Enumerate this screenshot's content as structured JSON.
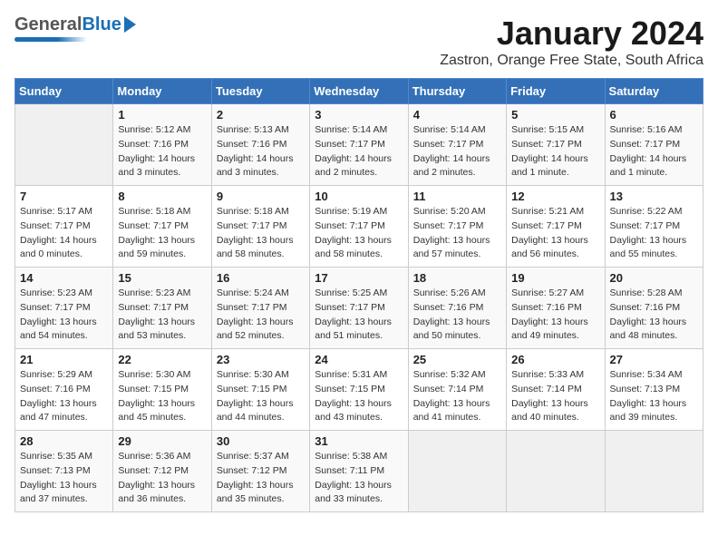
{
  "header": {
    "logo_general": "General",
    "logo_blue": "Blue",
    "month_year": "January 2024",
    "location": "Zastron, Orange Free State, South Africa"
  },
  "weekdays": [
    "Sunday",
    "Monday",
    "Tuesday",
    "Wednesday",
    "Thursday",
    "Friday",
    "Saturday"
  ],
  "weeks": [
    [
      {
        "day": "",
        "sunrise": "",
        "sunset": "",
        "daylight": ""
      },
      {
        "day": "1",
        "sunrise": "Sunrise: 5:12 AM",
        "sunset": "Sunset: 7:16 PM",
        "daylight": "Daylight: 14 hours and 3 minutes."
      },
      {
        "day": "2",
        "sunrise": "Sunrise: 5:13 AM",
        "sunset": "Sunset: 7:16 PM",
        "daylight": "Daylight: 14 hours and 3 minutes."
      },
      {
        "day": "3",
        "sunrise": "Sunrise: 5:14 AM",
        "sunset": "Sunset: 7:17 PM",
        "daylight": "Daylight: 14 hours and 2 minutes."
      },
      {
        "day": "4",
        "sunrise": "Sunrise: 5:14 AM",
        "sunset": "Sunset: 7:17 PM",
        "daylight": "Daylight: 14 hours and 2 minutes."
      },
      {
        "day": "5",
        "sunrise": "Sunrise: 5:15 AM",
        "sunset": "Sunset: 7:17 PM",
        "daylight": "Daylight: 14 hours and 1 minute."
      },
      {
        "day": "6",
        "sunrise": "Sunrise: 5:16 AM",
        "sunset": "Sunset: 7:17 PM",
        "daylight": "Daylight: 14 hours and 1 minute."
      }
    ],
    [
      {
        "day": "7",
        "sunrise": "Sunrise: 5:17 AM",
        "sunset": "Sunset: 7:17 PM",
        "daylight": "Daylight: 14 hours and 0 minutes."
      },
      {
        "day": "8",
        "sunrise": "Sunrise: 5:18 AM",
        "sunset": "Sunset: 7:17 PM",
        "daylight": "Daylight: 13 hours and 59 minutes."
      },
      {
        "day": "9",
        "sunrise": "Sunrise: 5:18 AM",
        "sunset": "Sunset: 7:17 PM",
        "daylight": "Daylight: 13 hours and 58 minutes."
      },
      {
        "day": "10",
        "sunrise": "Sunrise: 5:19 AM",
        "sunset": "Sunset: 7:17 PM",
        "daylight": "Daylight: 13 hours and 58 minutes."
      },
      {
        "day": "11",
        "sunrise": "Sunrise: 5:20 AM",
        "sunset": "Sunset: 7:17 PM",
        "daylight": "Daylight: 13 hours and 57 minutes."
      },
      {
        "day": "12",
        "sunrise": "Sunrise: 5:21 AM",
        "sunset": "Sunset: 7:17 PM",
        "daylight": "Daylight: 13 hours and 56 minutes."
      },
      {
        "day": "13",
        "sunrise": "Sunrise: 5:22 AM",
        "sunset": "Sunset: 7:17 PM",
        "daylight": "Daylight: 13 hours and 55 minutes."
      }
    ],
    [
      {
        "day": "14",
        "sunrise": "Sunrise: 5:23 AM",
        "sunset": "Sunset: 7:17 PM",
        "daylight": "Daylight: 13 hours and 54 minutes."
      },
      {
        "day": "15",
        "sunrise": "Sunrise: 5:23 AM",
        "sunset": "Sunset: 7:17 PM",
        "daylight": "Daylight: 13 hours and 53 minutes."
      },
      {
        "day": "16",
        "sunrise": "Sunrise: 5:24 AM",
        "sunset": "Sunset: 7:17 PM",
        "daylight": "Daylight: 13 hours and 52 minutes."
      },
      {
        "day": "17",
        "sunrise": "Sunrise: 5:25 AM",
        "sunset": "Sunset: 7:17 PM",
        "daylight": "Daylight: 13 hours and 51 minutes."
      },
      {
        "day": "18",
        "sunrise": "Sunrise: 5:26 AM",
        "sunset": "Sunset: 7:16 PM",
        "daylight": "Daylight: 13 hours and 50 minutes."
      },
      {
        "day": "19",
        "sunrise": "Sunrise: 5:27 AM",
        "sunset": "Sunset: 7:16 PM",
        "daylight": "Daylight: 13 hours and 49 minutes."
      },
      {
        "day": "20",
        "sunrise": "Sunrise: 5:28 AM",
        "sunset": "Sunset: 7:16 PM",
        "daylight": "Daylight: 13 hours and 48 minutes."
      }
    ],
    [
      {
        "day": "21",
        "sunrise": "Sunrise: 5:29 AM",
        "sunset": "Sunset: 7:16 PM",
        "daylight": "Daylight: 13 hours and 47 minutes."
      },
      {
        "day": "22",
        "sunrise": "Sunrise: 5:30 AM",
        "sunset": "Sunset: 7:15 PM",
        "daylight": "Daylight: 13 hours and 45 minutes."
      },
      {
        "day": "23",
        "sunrise": "Sunrise: 5:30 AM",
        "sunset": "Sunset: 7:15 PM",
        "daylight": "Daylight: 13 hours and 44 minutes."
      },
      {
        "day": "24",
        "sunrise": "Sunrise: 5:31 AM",
        "sunset": "Sunset: 7:15 PM",
        "daylight": "Daylight: 13 hours and 43 minutes."
      },
      {
        "day": "25",
        "sunrise": "Sunrise: 5:32 AM",
        "sunset": "Sunset: 7:14 PM",
        "daylight": "Daylight: 13 hours and 41 minutes."
      },
      {
        "day": "26",
        "sunrise": "Sunrise: 5:33 AM",
        "sunset": "Sunset: 7:14 PM",
        "daylight": "Daylight: 13 hours and 40 minutes."
      },
      {
        "day": "27",
        "sunrise": "Sunrise: 5:34 AM",
        "sunset": "Sunset: 7:13 PM",
        "daylight": "Daylight: 13 hours and 39 minutes."
      }
    ],
    [
      {
        "day": "28",
        "sunrise": "Sunrise: 5:35 AM",
        "sunset": "Sunset: 7:13 PM",
        "daylight": "Daylight: 13 hours and 37 minutes."
      },
      {
        "day": "29",
        "sunrise": "Sunrise: 5:36 AM",
        "sunset": "Sunset: 7:12 PM",
        "daylight": "Daylight: 13 hours and 36 minutes."
      },
      {
        "day": "30",
        "sunrise": "Sunrise: 5:37 AM",
        "sunset": "Sunset: 7:12 PM",
        "daylight": "Daylight: 13 hours and 35 minutes."
      },
      {
        "day": "31",
        "sunrise": "Sunrise: 5:38 AM",
        "sunset": "Sunset: 7:11 PM",
        "daylight": "Daylight: 13 hours and 33 minutes."
      },
      {
        "day": "",
        "sunrise": "",
        "sunset": "",
        "daylight": ""
      },
      {
        "day": "",
        "sunrise": "",
        "sunset": "",
        "daylight": ""
      },
      {
        "day": "",
        "sunrise": "",
        "sunset": "",
        "daylight": ""
      }
    ]
  ]
}
